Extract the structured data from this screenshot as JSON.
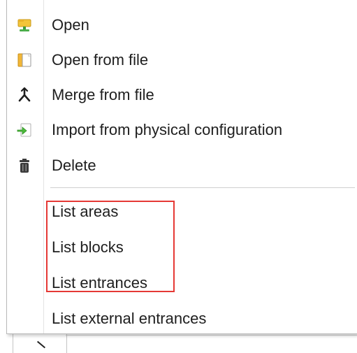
{
  "menu": {
    "items": [
      {
        "label": "Open",
        "icon": "open-folder-icon"
      },
      {
        "label": "Open from file",
        "icon": "open-file-icon"
      },
      {
        "label": "Merge from file",
        "icon": "merge-icon"
      },
      {
        "label": "Import from physical configuration",
        "icon": "import-icon"
      },
      {
        "label": "Delete",
        "icon": "trash-icon"
      },
      {
        "label": "List areas",
        "icon": ""
      },
      {
        "label": "List blocks",
        "icon": ""
      },
      {
        "label": "List entrances",
        "icon": ""
      },
      {
        "label": "List external entrances",
        "icon": ""
      }
    ]
  },
  "colors": {
    "highlight": "#e53935",
    "text": "#1e1e1e",
    "separator": "#cfcfcf"
  }
}
